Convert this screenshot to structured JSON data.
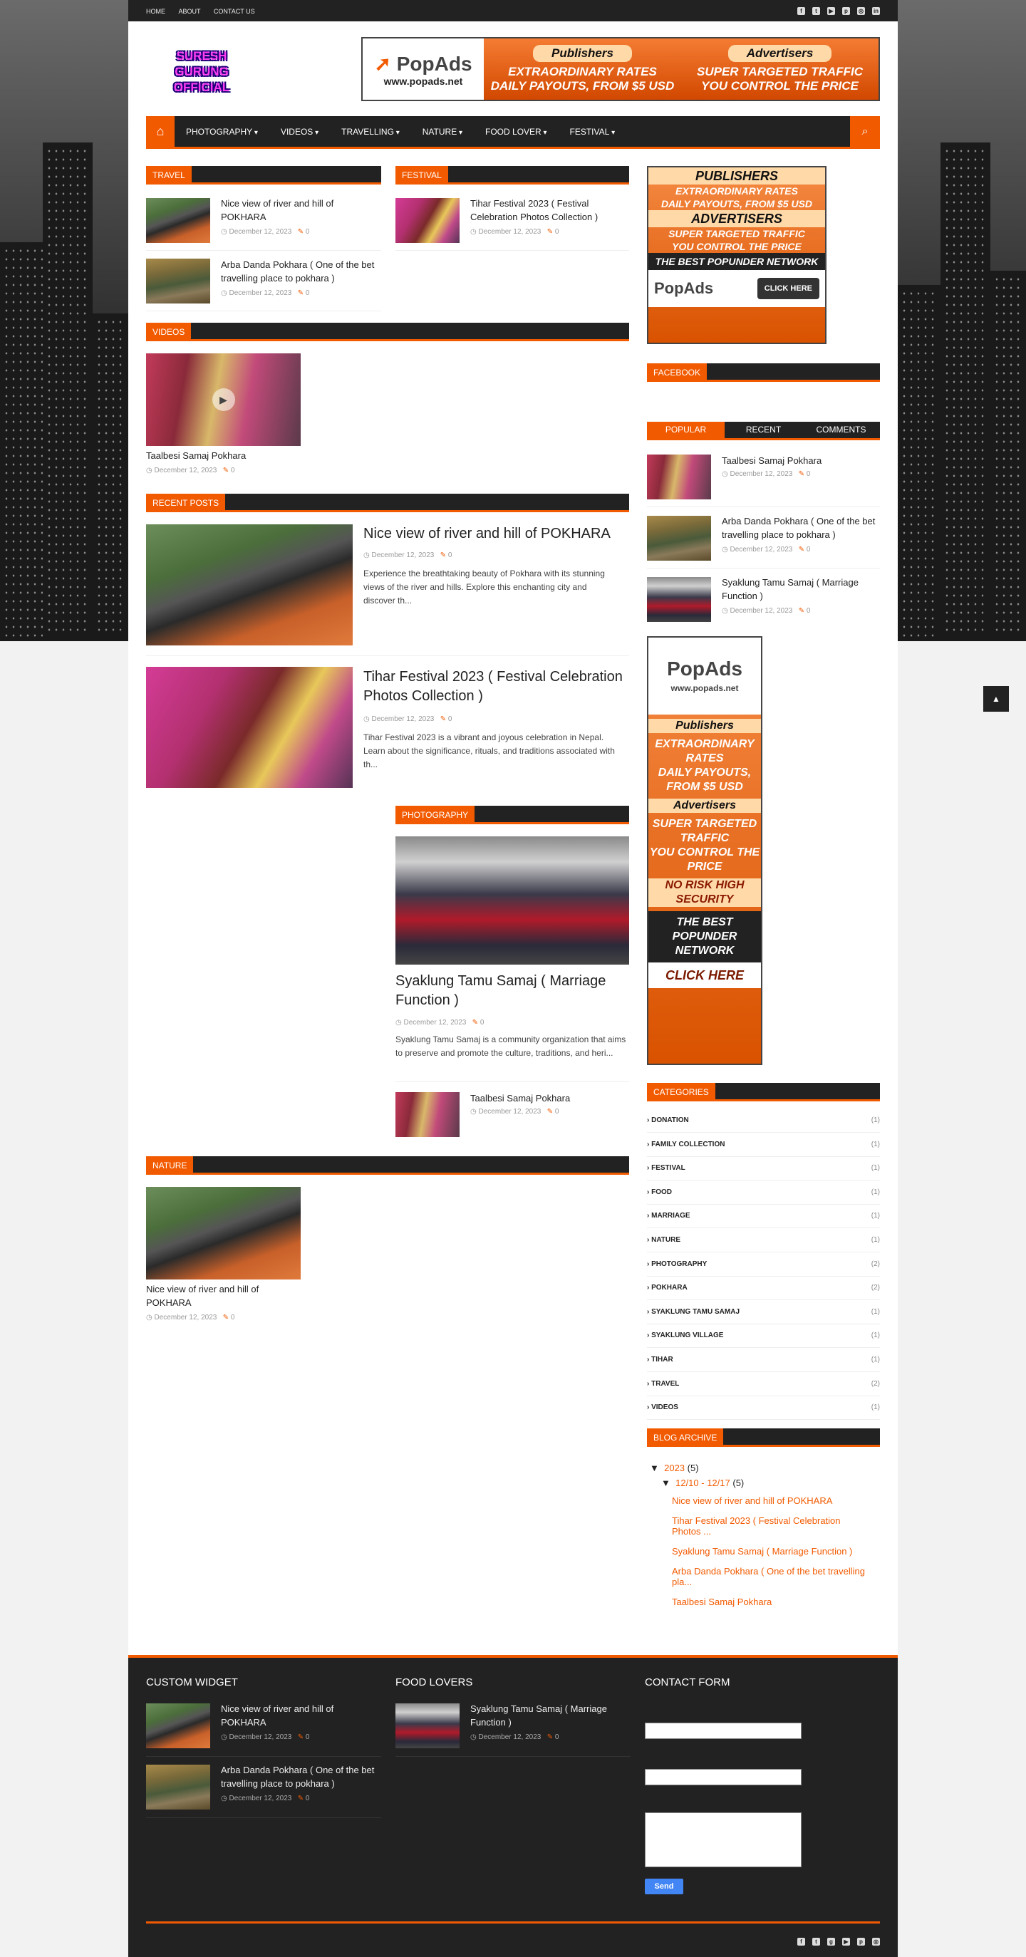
{
  "topbar": {
    "links": [
      "HOME",
      "ABOUT",
      "CONTACT US"
    ],
    "social_icons": [
      "facebook-icon",
      "twitter-icon",
      "youtube-icon",
      "pinterest-icon",
      "instagram-icon",
      "linkedin-icon"
    ]
  },
  "logo": {
    "line1": "SURESH GURUNG",
    "line2": "OFFICIAL"
  },
  "ad_banner": {
    "brand": "PopAds",
    "url": "www.popads.net",
    "pub_title": "Publishers",
    "pub_line1": "EXTRAORDINARY RATES",
    "pub_line2": "DAILY PAYOUTS, FROM $5 USD",
    "adv_title": "Advertisers",
    "adv_line1": "SUPER TARGETED TRAFFIC",
    "adv_line2": "YOU CONTROL THE PRICE"
  },
  "nav": {
    "items": [
      "PHOTOGRAPHY",
      "VIDEOS",
      "TRAVELLING",
      "NATURE",
      "FOOD LOVER",
      "FESTIVAL"
    ]
  },
  "posts": {
    "river": "Nice view of river and hill of POKHARA",
    "tihar": "Tihar Festival 2023 ( Festival Celebration Photos Collection )",
    "arba": "Arba Danda Pokhara ( One of the bet travelling place to pokhara )",
    "taalbesi": "Taalbesi Samaj Pokhara",
    "syaklung": "Syaklung Tamu Samaj ( Marriage Function )",
    "date": "December 12, 2023",
    "comments": "0"
  },
  "sections": {
    "travel": "TRAVEL",
    "festival": "FESTIVAL",
    "videos": "VIDEOS",
    "recent": "RECENT POSTS",
    "photography": "PHOTOGRAPHY",
    "nature": "NATURE"
  },
  "excerpts": {
    "river": "Experience the breathtaking beauty of Pokhara with its stunning views of the river and hills. Explore this enchanting city and discover th...",
    "tihar": "Tihar Festival 2023 is a vibrant and joyous celebration in Nepal. Learn about the significance, rituals, and traditions associated with th...",
    "syaklung": "Syaklung Tamu Samaj is a community organization that aims to preserve and promote the culture, traditions, and heri..."
  },
  "sidebar": {
    "ad1": {
      "publishers": "PUBLISHERS",
      "line1": "EXTRAORDINARY RATES",
      "line2": "DAILY PAYOUTS, FROM $5 USD",
      "advertisers": "ADVERTISERS",
      "line3": "SUPER TARGETED TRAFFIC",
      "line4": "YOU CONTROL THE PRICE",
      "line5": "THE BEST POPUNDER NETWORK",
      "brand": "PopAds",
      "cta": "CLICK HERE"
    },
    "facebook": "FACEBOOK",
    "tabs": [
      "POPULAR",
      "RECENT",
      "COMMENTS"
    ],
    "ad2": {
      "brand": "PopAds",
      "url": "www.popads.net",
      "publishers": "Publishers",
      "l1": "EXTRAORDINARY RATES",
      "l2": "DAILY PAYOUTS, FROM $5 USD",
      "advertisers": "Advertisers",
      "l3": "SUPER TARGETED TRAFFIC",
      "l4": "YOU CONTROL THE PRICE",
      "l5": "NO RISK HIGH SECURITY",
      "l6": "THE BEST POPUNDER NETWORK",
      "cta": "CLICK HERE"
    },
    "categories_title": "CATEGORIES",
    "categories": [
      {
        "name": "DONATION",
        "count": "(1)"
      },
      {
        "name": "FAMILY COLLECTION",
        "count": "(1)"
      },
      {
        "name": "FESTIVAL",
        "count": "(1)"
      },
      {
        "name": "FOOD",
        "count": "(1)"
      },
      {
        "name": "MARRIAGE",
        "count": "(1)"
      },
      {
        "name": "NATURE",
        "count": "(1)"
      },
      {
        "name": "PHOTOGRAPHY",
        "count": "(2)"
      },
      {
        "name": "POKHARA",
        "count": "(2)"
      },
      {
        "name": "SYAKLUNG TAMU SAMAJ",
        "count": "(1)"
      },
      {
        "name": "SYAKLUNG VILLAGE",
        "count": "(1)"
      },
      {
        "name": "TIHAR",
        "count": "(1)"
      },
      {
        "name": "TRAVEL",
        "count": "(2)"
      },
      {
        "name": "VIDEOS",
        "count": "(1)"
      }
    ],
    "archive_title": "BLOG ARCHIVE",
    "archive": {
      "year": "2023",
      "year_count": "(5)",
      "week": "12/10 - 12/17",
      "week_count": "(5)",
      "posts": [
        "Nice view of river and hill of POKHARA",
        "Tihar Festival 2023 ( Festival Celebration Photos ...",
        "Syaklung Tamu Samaj ( Marriage Function )",
        "Arba Danda Pokhara ( One of the bet travelling pla...",
        "Taalbesi Samaj Pokhara"
      ]
    }
  },
  "footer": {
    "custom_widget": "CUSTOM WIDGET",
    "food_lovers": "FOOD LOVERS",
    "contact_form": "CONTACT FORM",
    "send": "Send"
  },
  "colors": {
    "accent": "#f25a00",
    "dark": "#222222",
    "send_button": "#4285f4"
  }
}
